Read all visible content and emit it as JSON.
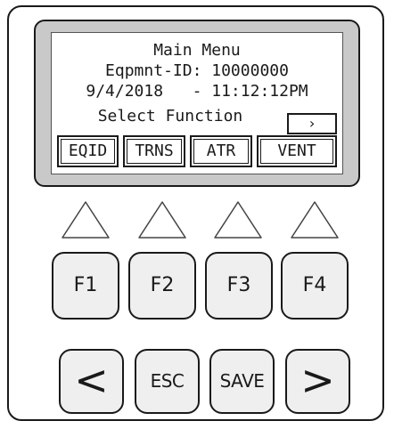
{
  "screen": {
    "title": "Main Menu",
    "equipment_id_line": "Eqpmnt-ID: 10000000",
    "datetime_line": "9/4/2018   - 11:12:12PM",
    "prompt": "Select Function",
    "more_indicator": "›",
    "softkey_labels": [
      "EQID",
      "TRNS",
      "ATR",
      "VENT"
    ]
  },
  "keys": {
    "function": [
      "F1",
      "F2",
      "F3",
      "F4"
    ],
    "left": "<",
    "esc": "ESC",
    "save": "SAVE",
    "right": ">"
  },
  "icons": {
    "softkey_indicator": "up-triangle-outline"
  }
}
